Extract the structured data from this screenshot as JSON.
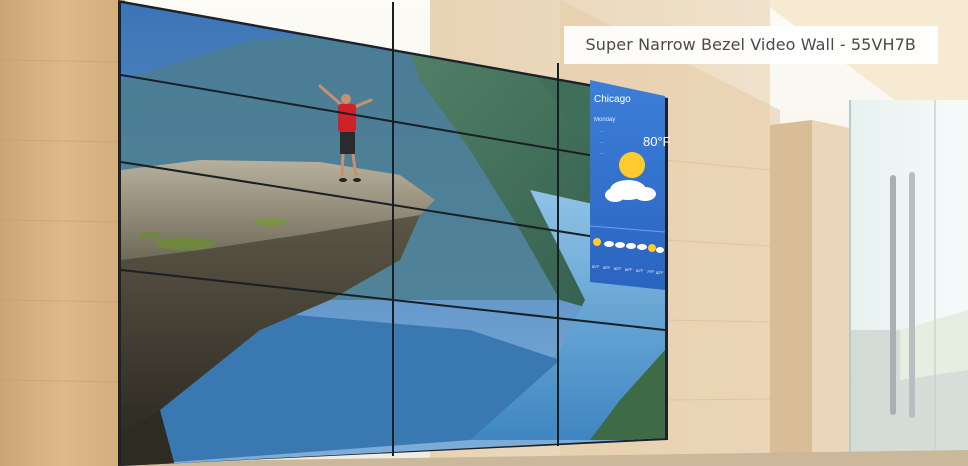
{
  "caption": "Super Narrow Bezel Video Wall - 55VH7B",
  "weather": {
    "city": "Chicago",
    "day": "Monday",
    "temperature": "80°F",
    "details": [
      "---",
      "---",
      "---"
    ],
    "forecast_temps": [
      "81°F",
      "80°F",
      "82°F",
      "80°F",
      "81°F",
      "79°F",
      "82°F"
    ]
  },
  "colors": {
    "wall_wood": "#d8b685",
    "sky": "#4a86c9",
    "water": "#5aa4d8",
    "cliff": "#7a7560",
    "shirt": "#d0202a",
    "bezel": "#1c2229"
  }
}
